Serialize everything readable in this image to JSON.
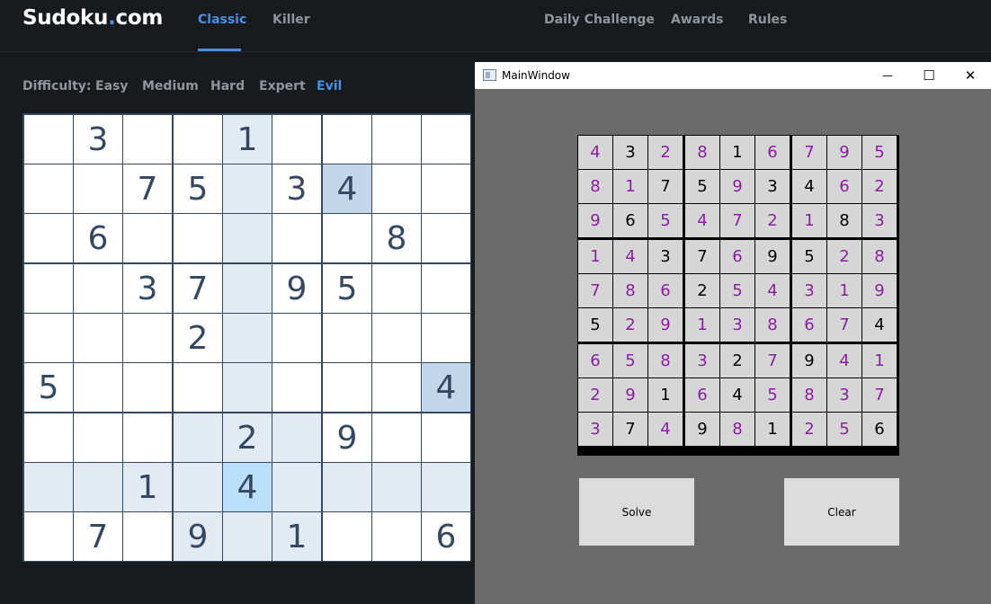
{
  "site": {
    "logo_main": "Sudoku",
    "logo_dot": ".",
    "logo_tld": "com",
    "tabs": [
      {
        "label": "Classic",
        "active": true
      },
      {
        "label": "Killer",
        "active": false
      }
    ],
    "links": [
      "Daily Challenge",
      "Awards",
      "Rules"
    ],
    "difficulty_label": "Difficulty:",
    "difficulties": [
      {
        "label": "Easy",
        "active": false
      },
      {
        "label": "Medium",
        "active": false
      },
      {
        "label": "Hard",
        "active": false
      },
      {
        "label": "Expert",
        "active": false
      },
      {
        "label": "Evil",
        "active": true
      }
    ],
    "colors": {
      "accent": "#4a90e2",
      "background": "#181b1e",
      "board_ink": "#344861"
    }
  },
  "board": {
    "rows": [
      [
        "",
        "3",
        "",
        "",
        "1",
        "",
        "",
        "",
        ""
      ],
      [
        "",
        "",
        "7",
        "5",
        "",
        "3",
        "4",
        "",
        ""
      ],
      [
        "",
        "6",
        "",
        "",
        "",
        "",
        "",
        "8",
        ""
      ],
      [
        "",
        "",
        "3",
        "7",
        "",
        "9",
        "5",
        "",
        ""
      ],
      [
        "",
        "",
        "",
        "2",
        "",
        "",
        "",
        "",
        ""
      ],
      [
        "5",
        "",
        "",
        "",
        "",
        "",
        "",
        "",
        "4"
      ],
      [
        "",
        "",
        "",
        "",
        "2",
        "",
        "9",
        "",
        ""
      ],
      [
        "",
        "",
        "1",
        "",
        "4",
        "",
        "",
        "",
        ""
      ],
      [
        "",
        "7",
        "",
        "9",
        "",
        "1",
        "",
        "",
        "6"
      ]
    ],
    "selected_cell": [
      7,
      4
    ],
    "highlight": {
      "selected": "#bbdefb",
      "same_value": "#c3d7ea",
      "related": "#e2ebf3"
    }
  },
  "solver_window": {
    "title": "MainWindow",
    "controls": {
      "minimize": "—",
      "maximize": "☐",
      "close": "✕"
    },
    "grid": [
      [
        "4",
        "3",
        "2",
        "8",
        "1",
        "6",
        "7",
        "9",
        "5"
      ],
      [
        "8",
        "1",
        "7",
        "5",
        "9",
        "3",
        "4",
        "6",
        "2"
      ],
      [
        "9",
        "6",
        "5",
        "4",
        "7",
        "2",
        "1",
        "8",
        "3"
      ],
      [
        "1",
        "4",
        "3",
        "7",
        "6",
        "9",
        "5",
        "2",
        "8"
      ],
      [
        "7",
        "8",
        "6",
        "2",
        "5",
        "4",
        "3",
        "1",
        "9"
      ],
      [
        "5",
        "2",
        "9",
        "1",
        "3",
        "8",
        "6",
        "7",
        "4"
      ],
      [
        "6",
        "5",
        "8",
        "3",
        "2",
        "7",
        "9",
        "4",
        "1"
      ],
      [
        "2",
        "9",
        "1",
        "6",
        "4",
        "5",
        "8",
        "3",
        "7"
      ],
      [
        "3",
        "7",
        "4",
        "9",
        "8",
        "1",
        "2",
        "5",
        "6"
      ]
    ],
    "given_mask": [
      [
        0,
        1,
        0,
        0,
        1,
        0,
        0,
        0,
        0
      ],
      [
        0,
        0,
        1,
        1,
        0,
        1,
        1,
        0,
        0
      ],
      [
        0,
        1,
        0,
        0,
        0,
        0,
        0,
        1,
        0
      ],
      [
        0,
        0,
        1,
        1,
        0,
        1,
        1,
        0,
        0
      ],
      [
        0,
        0,
        0,
        1,
        0,
        0,
        0,
        0,
        0
      ],
      [
        1,
        0,
        0,
        0,
        0,
        0,
        0,
        0,
        1
      ],
      [
        0,
        0,
        0,
        0,
        1,
        0,
        1,
        0,
        0
      ],
      [
        0,
        0,
        1,
        0,
        1,
        0,
        0,
        0,
        0
      ],
      [
        0,
        1,
        0,
        1,
        0,
        1,
        0,
        0,
        1
      ]
    ],
    "solve_label": "Solve",
    "clear_label": "Clear",
    "colors": {
      "window_bg": "#6b6b6b",
      "cell_bg": "#d6d6d6",
      "given": "#000000",
      "solved": "#8a1ea0"
    }
  }
}
